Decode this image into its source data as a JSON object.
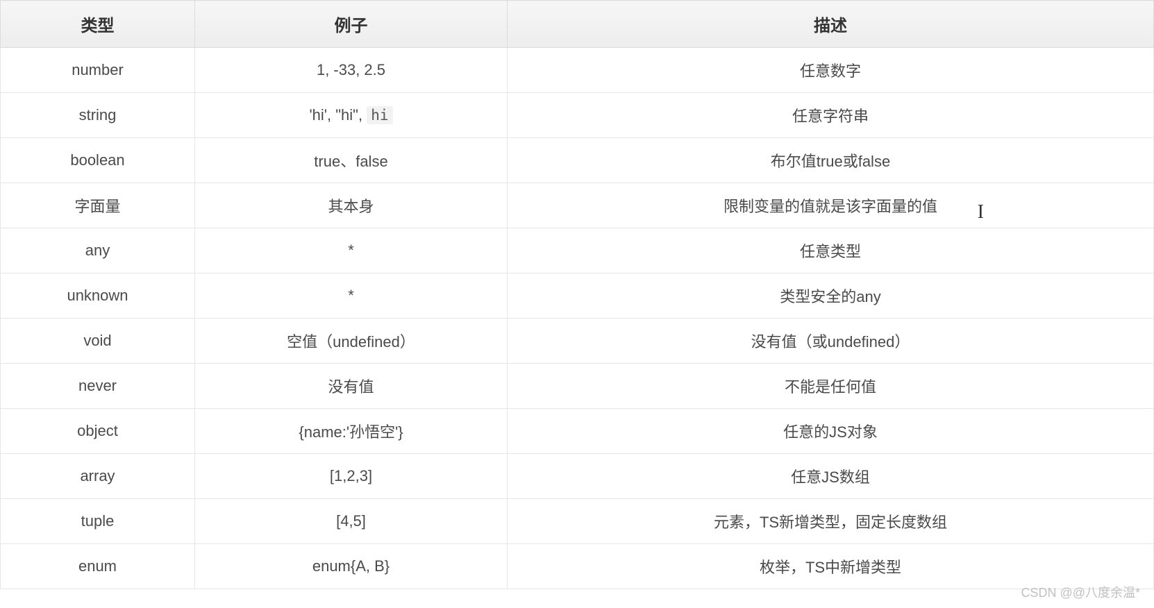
{
  "table": {
    "headers": [
      "类型",
      "例子",
      "描述"
    ],
    "rows": [
      {
        "type": "number",
        "example_parts": [
          "1, -33, 2.5"
        ],
        "example_code": "",
        "desc": "任意数字"
      },
      {
        "type": "string",
        "example_parts": [
          "'hi', \"hi\", "
        ],
        "example_code": "hi",
        "desc": "任意字符串"
      },
      {
        "type": "boolean",
        "example_parts": [
          "true、false"
        ],
        "example_code": "",
        "desc": "布尔值true或false"
      },
      {
        "type": "字面量",
        "example_parts": [
          "其本身"
        ],
        "example_code": "",
        "desc": "限制变量的值就是该字面量的值"
      },
      {
        "type": "any",
        "example_parts": [
          "*"
        ],
        "example_code": "",
        "desc": "任意类型"
      },
      {
        "type": "unknown",
        "example_parts": [
          "*"
        ],
        "example_code": "",
        "desc": "类型安全的any"
      },
      {
        "type": "void",
        "example_parts": [
          "空值（undefined）"
        ],
        "example_code": "",
        "desc": "没有值（或undefined）"
      },
      {
        "type": "never",
        "example_parts": [
          "没有值"
        ],
        "example_code": "",
        "desc": "不能是任何值"
      },
      {
        "type": "object",
        "example_parts": [
          "{name:'孙悟空'}"
        ],
        "example_code": "",
        "desc": "任意的JS对象"
      },
      {
        "type": "array",
        "example_parts": [
          "[1,2,3]"
        ],
        "example_code": "",
        "desc": "任意JS数组"
      },
      {
        "type": "tuple",
        "example_parts": [
          "[4,5]"
        ],
        "example_code": "",
        "desc": "元素，TS新增类型，固定长度数组"
      },
      {
        "type": "enum",
        "example_parts": [
          "enum{A, B}"
        ],
        "example_code": "",
        "desc": "枚举，TS中新增类型"
      }
    ]
  },
  "watermark": "CSDN @@八度余温*"
}
